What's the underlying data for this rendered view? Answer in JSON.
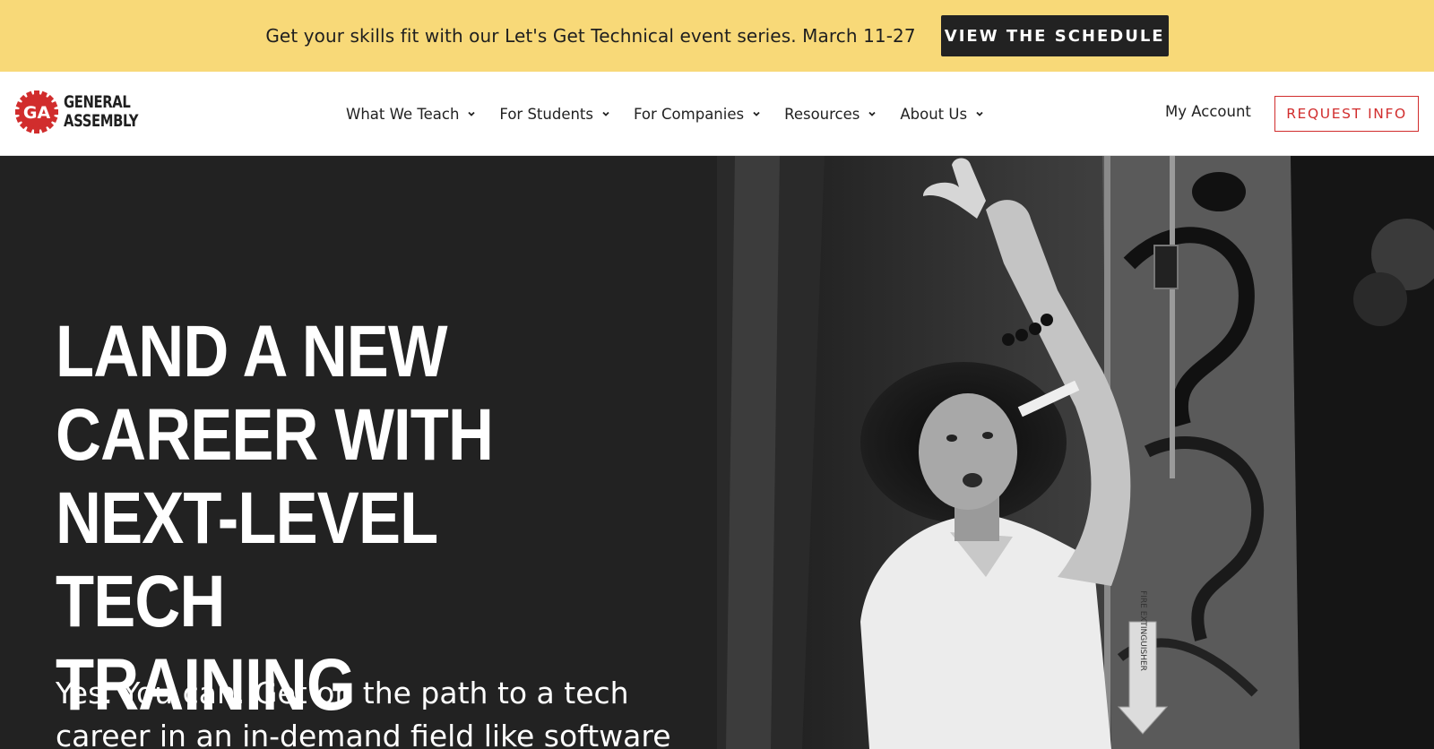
{
  "banner": {
    "text": "Get your skills fit with our Let's Get Technical event series. March 11-27",
    "button_label": "VIEW THE SCHEDULE"
  },
  "header": {
    "logo": {
      "mark": "GA",
      "line1": "GENERAL",
      "line2": "ASSEMBLY",
      "color": "#d12d2d"
    },
    "nav_items": [
      {
        "label": "What We Teach",
        "icon": "chevron-down-icon"
      },
      {
        "label": "For Students",
        "icon": "chevron-down-icon"
      },
      {
        "label": "For Companies",
        "icon": "chevron-down-icon"
      },
      {
        "label": "Resources",
        "icon": "chevron-down-icon"
      },
      {
        "label": "About Us",
        "icon": "chevron-down-icon"
      }
    ],
    "account_link": "My Account",
    "request_button": "REQUEST INFO"
  },
  "hero": {
    "title_lines": [
      "LAND A NEW",
      "CAREER WITH",
      "NEXT-LEVEL TECH",
      "TRAINING"
    ],
    "subtitle_lines": [
      "Yes. You can. Get on the path to a tech",
      "career in an in-demand field like software"
    ],
    "image_sign_text": "FIRE EXTINGUISHER"
  },
  "colors": {
    "banner_bg": "#f8d978",
    "brand_red": "#d12d2d",
    "dark_bg": "#222222",
    "button_dark": "#222222"
  }
}
